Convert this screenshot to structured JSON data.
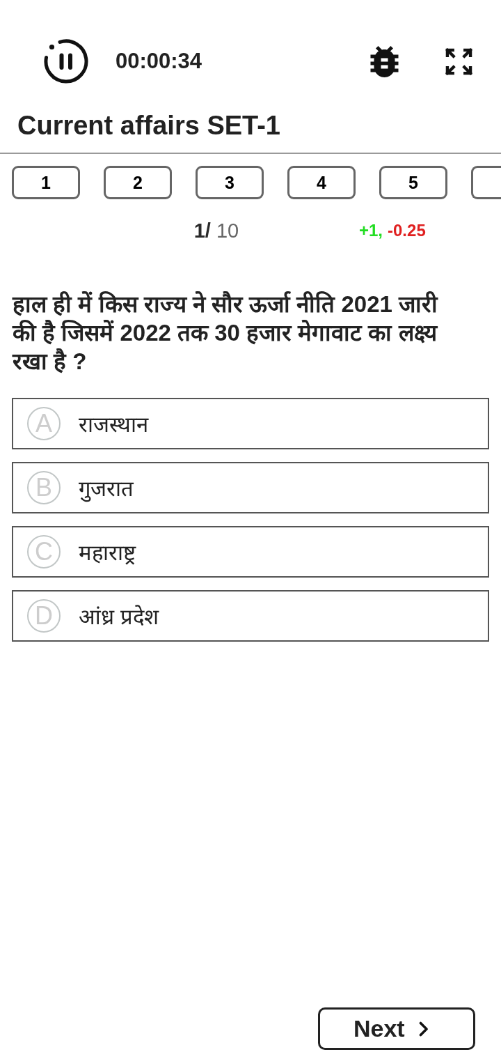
{
  "header": {
    "timer": "00:00:34"
  },
  "title": "Current affairs SET-1",
  "question_tabs": [
    {
      "kind": "number",
      "label": "1"
    },
    {
      "kind": "number",
      "label": "2"
    },
    {
      "kind": "number",
      "label": "3"
    },
    {
      "kind": "number",
      "label": "4"
    },
    {
      "kind": "number",
      "label": "5"
    },
    {
      "kind": "cut"
    }
  ],
  "progress": {
    "counter": "**1/** 10",
    "marks_correct": "+1,",
    "marks_wrong": "-0.25"
  },
  "question": "हाल ही में किस राज्य ने सौर ऊर्जा नीति 2021 जारी की है जिसमें 2022 तक 30 हजार मेगावाट का लक्ष्य रखा है ?",
  "options": [
    {
      "letter": "A",
      "text": "राजस्थान"
    },
    {
      "letter": "B",
      "text": "गुजरात"
    },
    {
      "letter": "C",
      "text": "महाराष्ट्र"
    },
    {
      "letter": "D",
      "text": "आंध्र प्रदेश"
    }
  ],
  "next_button": {
    "label": "Next"
  }
}
